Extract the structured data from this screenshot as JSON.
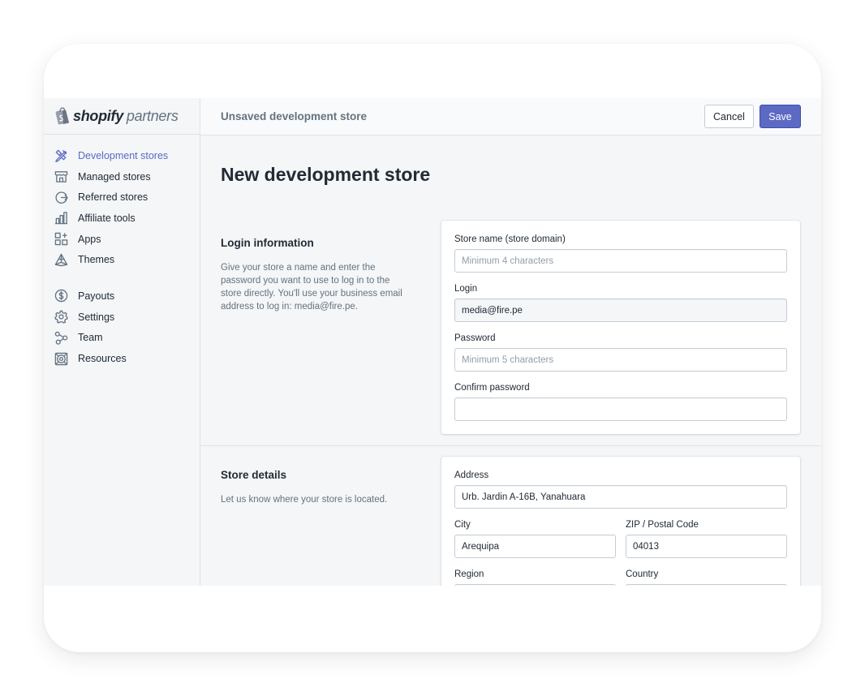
{
  "brand": {
    "name_bold": "shopify",
    "name_light": "partners",
    "accent": "#5c6ac4",
    "logo_icon": "shopping-bag-icon"
  },
  "sidebar": {
    "items": [
      {
        "label": "Development stores",
        "icon": "wrench-pencil-icon",
        "active": true
      },
      {
        "label": "Managed stores",
        "icon": "storefront-icon"
      },
      {
        "label": "Referred stores",
        "icon": "redirect-circle-icon"
      },
      {
        "label": "Affiliate tools",
        "icon": "bar-chart-icon"
      },
      {
        "label": "Apps",
        "icon": "apps-grid-icon"
      },
      {
        "label": "Themes",
        "icon": "theme-icon"
      },
      {
        "label": "Payouts",
        "icon": "dollar-circle-icon"
      },
      {
        "label": "Settings",
        "icon": "gear-icon"
      },
      {
        "label": "Team",
        "icon": "team-icon"
      },
      {
        "label": "Resources",
        "icon": "lifebuoy-icon"
      }
    ]
  },
  "topbar": {
    "title": "Unsaved development store",
    "cancel_label": "Cancel",
    "save_label": "Save"
  },
  "page": {
    "title": "New development store"
  },
  "login_section": {
    "title": "Login information",
    "description": "Give your store a name and enter the password you want to use to log in to the store directly. You'll use your business email address to log in: media@fire.pe.",
    "fields": {
      "store_name": {
        "label": "Store name (store domain)",
        "value": "",
        "placeholder": "Minimum 4 characters"
      },
      "login": {
        "label": "Login",
        "value": "media@fire.pe",
        "placeholder": ""
      },
      "password": {
        "label": "Password",
        "value": "",
        "placeholder": "Minimum 5 characters"
      },
      "confirm_password": {
        "label": "Confirm password",
        "value": "",
        "placeholder": ""
      }
    }
  },
  "store_section": {
    "title": "Store details",
    "description": "Let us know where your store is located.",
    "fields": {
      "address": {
        "label": "Address",
        "value": "Urb. Jardin A-16B, Yanahuara"
      },
      "city": {
        "label": "City",
        "value": "Arequipa"
      },
      "zip": {
        "label": "ZIP / Postal Code",
        "value": "04013"
      },
      "region": {
        "label": "Region",
        "value": ""
      },
      "country": {
        "label": "Country",
        "value": ""
      }
    }
  }
}
